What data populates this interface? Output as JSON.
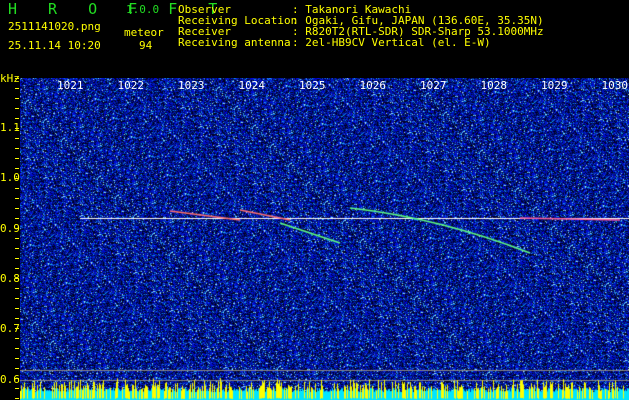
{
  "app": {
    "name": "H R O F F T",
    "version": "1.0.0"
  },
  "file": {
    "name": "2511141020.png",
    "datetime": "25.11.14 10:20"
  },
  "meteor": {
    "label": "meteor",
    "count": "94"
  },
  "info": [
    {
      "label": "Observer",
      "value": ": Takanori Kawachi"
    },
    {
      "label": "Receiving Location",
      "value": ": Ogaki, Gifu, JAPAN (136.60E, 35.35N)"
    },
    {
      "label": "Receiver",
      "value": ": R820T2(RTL-SDR) SDR-Sharp 53.1000MHz"
    },
    {
      "label": "Receiving antenna",
      "value": ": 2el-HB9CV Vertical (el. E-W)"
    }
  ],
  "axis": {
    "unit": "kHz",
    "y_ticks": [
      "1.1",
      "1.0",
      "0.9",
      "0.8",
      "0.7",
      "0.6"
    ],
    "x_ticks": [
      "1021",
      "1022",
      "1023",
      "1024",
      "1025",
      "1026",
      "1027",
      "1028",
      "1029",
      "1030"
    ]
  },
  "colors": {
    "background": "#000000",
    "text": "#ffff00",
    "title": "#22dd22",
    "noise": "#1020c0",
    "signal_line": "#ffffff",
    "level_bar": "#00e5ff",
    "level_peak": "#ffff00"
  }
}
